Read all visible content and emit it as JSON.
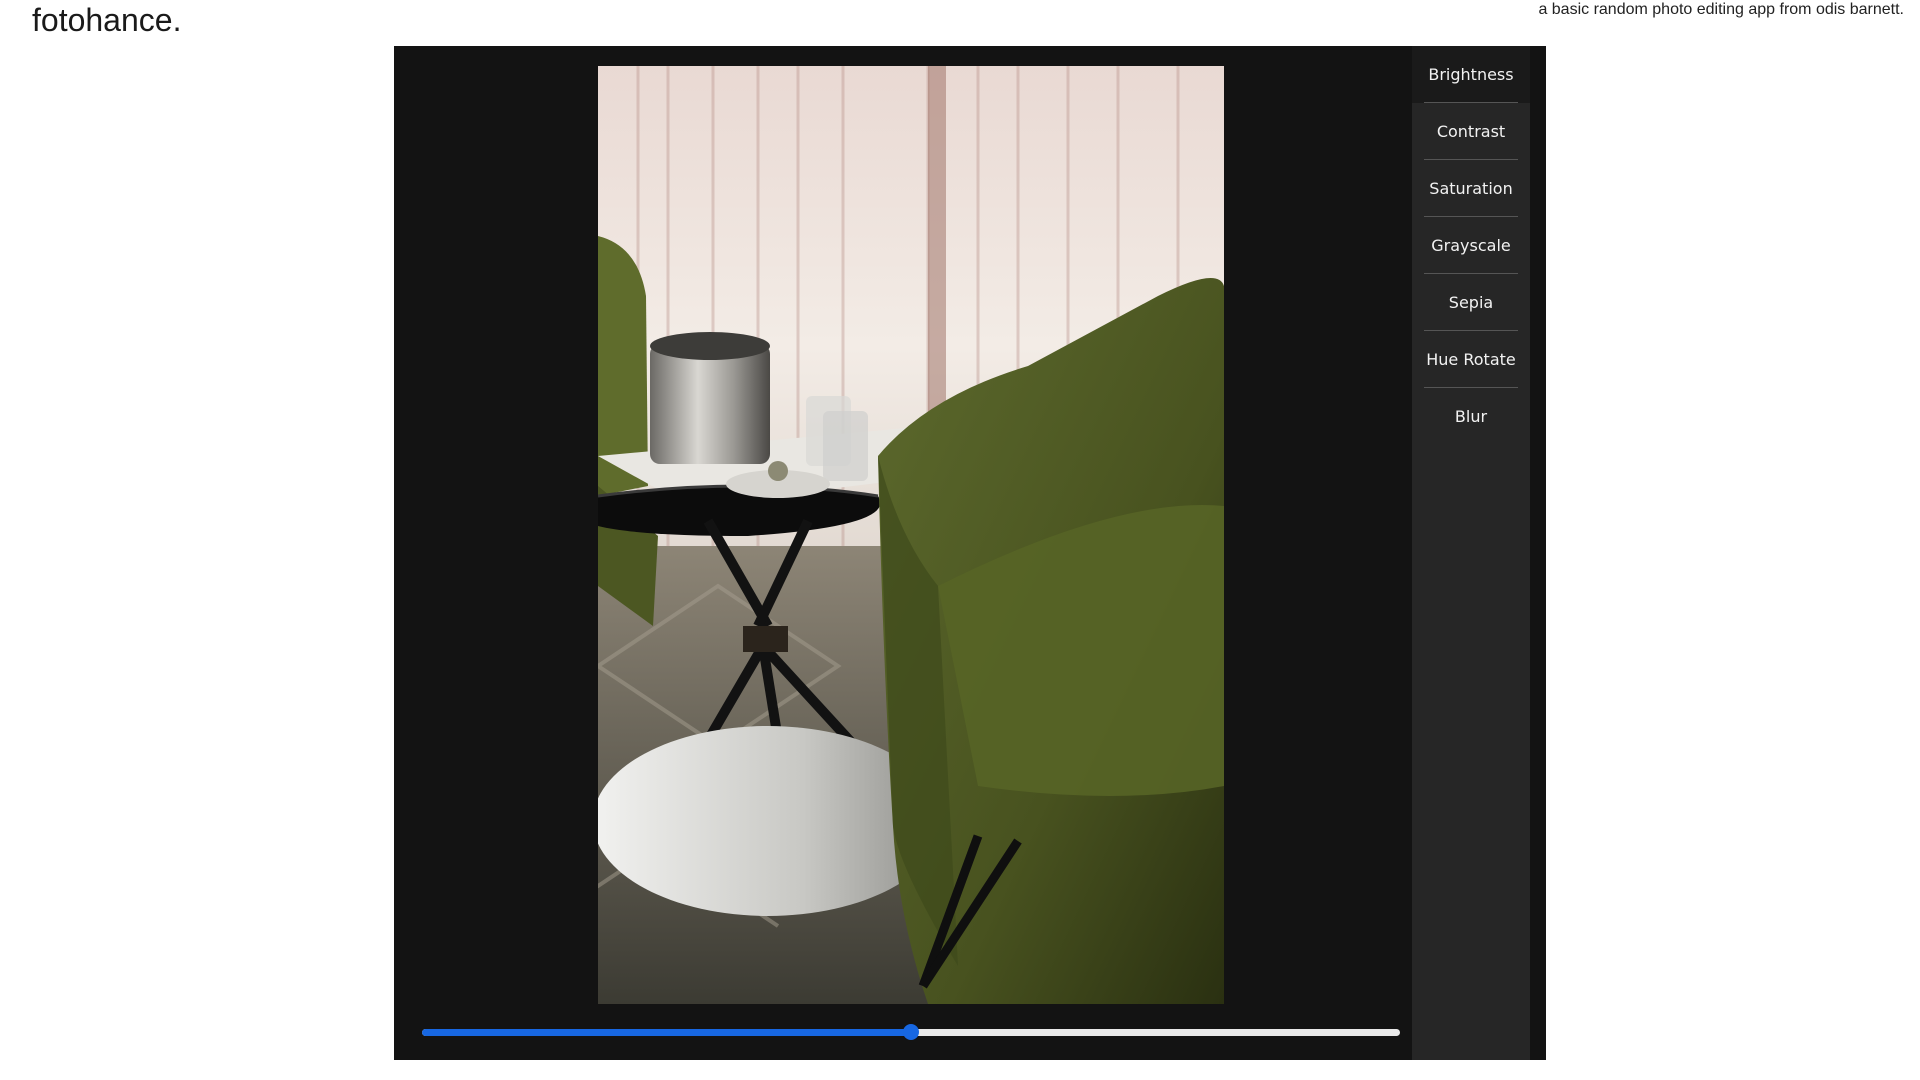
{
  "header": {
    "brand": "fotohance.",
    "tagline": "a basic random photo editing app from odis barnett."
  },
  "sidebar": {
    "items": [
      {
        "label": "Brightness",
        "active": true
      },
      {
        "label": "Contrast",
        "active": false
      },
      {
        "label": "Saturation",
        "active": false
      },
      {
        "label": "Grayscale",
        "active": false
      },
      {
        "label": "Sepia",
        "active": false
      },
      {
        "label": "Hue Rotate",
        "active": false
      },
      {
        "label": "Blur",
        "active": false
      }
    ]
  },
  "slider": {
    "value_fraction": 0.5,
    "accent_color": "#1767e2",
    "track_color": "#e9e9e9"
  },
  "colors": {
    "editor_bg": "#131313",
    "sidebar_bg": "#262626"
  },
  "preview": {
    "image_subject": "photo-of-green-armchair-and-side-table"
  }
}
